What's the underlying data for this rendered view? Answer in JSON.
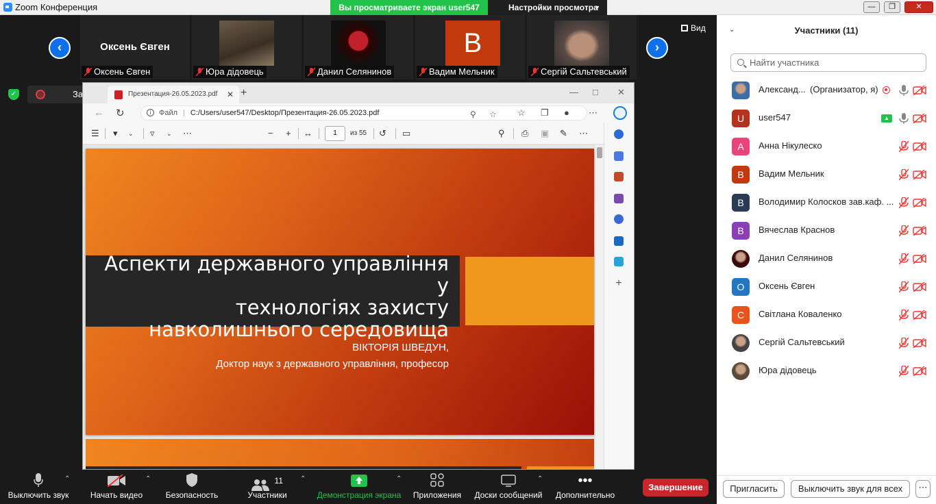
{
  "window": {
    "title": "Zoom Конференция",
    "share_banner": "Вы просматриваете экран user547",
    "view_options": "Настройки просмотра"
  },
  "strip": {
    "view_label": "Вид",
    "tiles": [
      {
        "name": "Оксень Євген",
        "label": "Оксень Євген"
      },
      {
        "label": "Юра дідовець"
      },
      {
        "label": "Данил Селянинов"
      },
      {
        "letter": "В",
        "label": "Вадим Мельник"
      },
      {
        "label": "Сергій Сальтевський"
      }
    ]
  },
  "recording": {
    "label": "Запись..."
  },
  "browser": {
    "tab_title": "Презентация-26.05.2023.pdf",
    "url_scheme": "Файл",
    "url": "C:/Users/user547/Desktop/Презентация-26.05.2023.pdf",
    "page_current": "1",
    "page_total": "из 55"
  },
  "slide": {
    "title_line1": "Аспекти державного управління у",
    "title_line2": "технологіях захисту",
    "title_line3": "навколишнього середовища",
    "author": "ВІКТОРІЯ ШВЕДУН,",
    "degree": "Доктор наук з державного управління, професор"
  },
  "toolbar": {
    "mute": "Выключить звук",
    "video": "Начать видео",
    "security": "Безопасность",
    "participants": "Участники",
    "participants_count": "11",
    "share": "Демонстрация экрана",
    "apps": "Приложения",
    "whiteboards": "Доски сообщений",
    "more": "Дополнительно",
    "end": "Завершение"
  },
  "panel": {
    "title": "Участники (11)",
    "search_placeholder": "Найти участника",
    "invite": "Пригласить",
    "mute_all": "Выключить звук для всех",
    "participants": [
      {
        "name": "Александ...",
        "role": "(Организатор, я)",
        "avatar": "",
        "color": "#3a6ea5",
        "photo": true
      },
      {
        "name": "user547",
        "role": "",
        "avatar": "U",
        "color": "#b5321c"
      },
      {
        "name": "Анна Нікулеско",
        "role": "",
        "avatar": "А",
        "color": "#e8437b"
      },
      {
        "name": "Вадим Мельник",
        "role": "",
        "avatar": "В",
        "color": "#c1390d"
      },
      {
        "name": "Володимир Колосков зав.каф. ...",
        "role": "",
        "avatar": "В",
        "color": "#2a3b55"
      },
      {
        "name": "Вячеслав Краснов",
        "role": "",
        "avatar": "В",
        "color": "#8b3fb5"
      },
      {
        "name": "Данил Селянинов",
        "role": "",
        "avatar": "",
        "color": "#3a0a0a",
        "photo": true
      },
      {
        "name": "Оксень Євген",
        "role": "",
        "avatar": "О",
        "color": "#2377c1"
      },
      {
        "name": "Світлана Коваленко",
        "role": "",
        "avatar": "С",
        "color": "#e8541c"
      },
      {
        "name": "Сергій Сальтевський",
        "role": "",
        "avatar": "",
        "color": "#444",
        "photo": true
      },
      {
        "name": "Юра дідовець",
        "role": "",
        "avatar": "",
        "color": "#5a4a3a",
        "photo": true
      }
    ]
  }
}
